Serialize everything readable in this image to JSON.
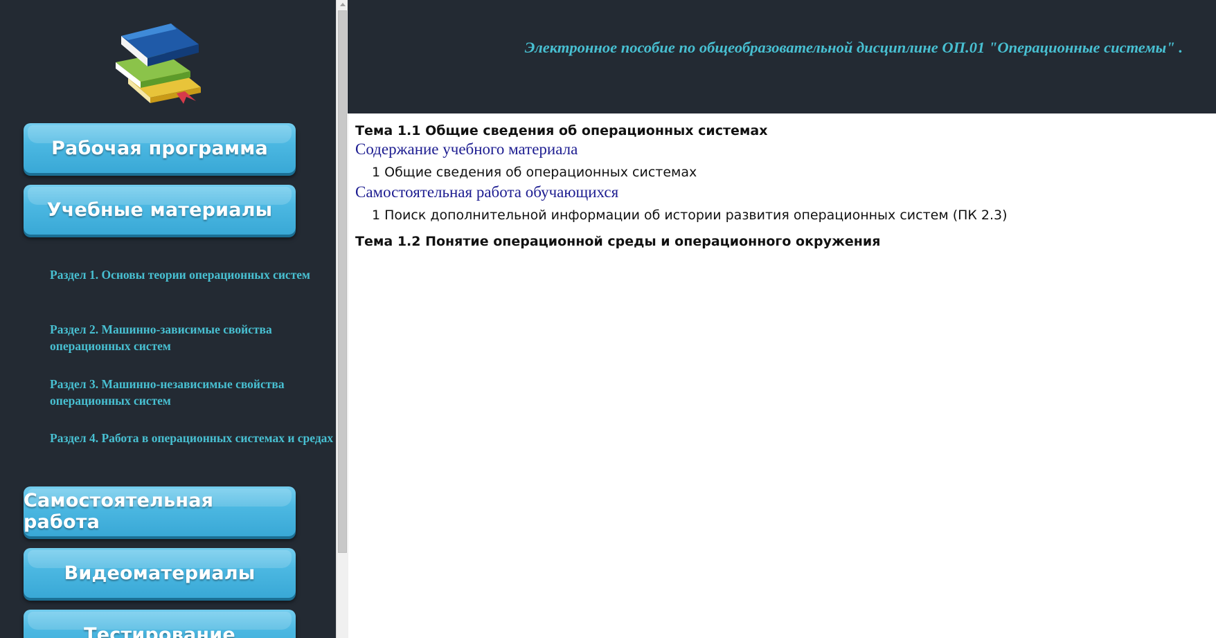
{
  "header": {
    "title": "Электронное пособие по общеобразовательной дисциплине ОП.01 \"Операционные системы\" ."
  },
  "sidebar": {
    "logo_icon": "books-stack-icon",
    "buttons": {
      "work_program": "Рабочая программа",
      "study_materials": "Учебные материалы",
      "independent_work": "Самостоятельная работа",
      "video_materials": "Видеоматериалы",
      "testing": "Тестирование"
    },
    "sections": [
      "Раздел 1. Основы теории операционных систем",
      "Раздел 2. Машинно-зависимые свойства операционных систем",
      "Раздел 3. Машинно-независимые свойства операционных систем",
      "Раздел 4. Работа в операционных системах и средах"
    ]
  },
  "content": {
    "topics": [
      {
        "title": "Тема 1.1 Общие сведения об операционных системах",
        "blocks": [
          {
            "heading": "Содержание учебного материала",
            "items": [
              "1 Общие сведения об операционных системах"
            ]
          },
          {
            "heading": "Самостоятельная работа обучающихся",
            "items": [
              "1 Поиск дополнительной информации об истории развития операционных систем (ПК 2.3)"
            ]
          }
        ]
      },
      {
        "title": "Тема 1.2 Понятие операционной среды и операционного окружения",
        "blocks": []
      }
    ]
  },
  "colors": {
    "sidebar_bg": "#232a33",
    "accent_teal": "#48c0d2",
    "button_blue": "#4cb8e2",
    "link_navy": "#1c1c90"
  }
}
